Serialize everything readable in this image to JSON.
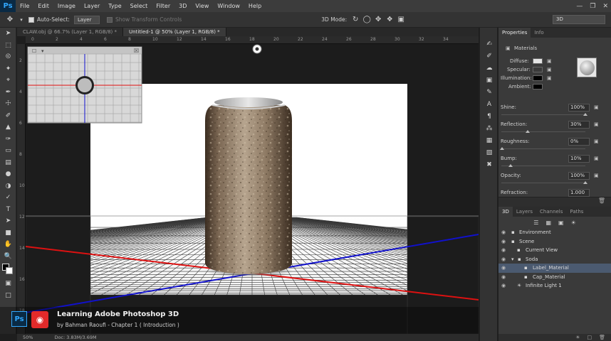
{
  "app": {
    "logo": "Ps"
  },
  "menu": [
    "File",
    "Edit",
    "Image",
    "Layer",
    "Type",
    "Select",
    "Filter",
    "3D",
    "View",
    "Window",
    "Help"
  ],
  "options": {
    "auto_select_label": "Auto-Select:",
    "auto_select_value": "Layer",
    "show_transform_label": "Show Transform Controls",
    "mode_label": "3D Mode:",
    "workspace": "3D"
  },
  "tabs": [
    {
      "label": "CLAW.obj @ 66.7% (Layer 1, RGB/8) *",
      "active": false
    },
    {
      "label": "Untitled-1 @ 50% (Layer 1, RGB/8) *",
      "active": true
    }
  ],
  "ruler_top": [
    "0",
    "2",
    "4",
    "6",
    "8",
    "10",
    "12",
    "14",
    "16",
    "18",
    "20",
    "22",
    "24",
    "26",
    "28",
    "30",
    "32",
    "34"
  ],
  "ruler_left": [
    "2",
    "4",
    "6",
    "8",
    "10",
    "12",
    "14",
    "16",
    "18"
  ],
  "status": {
    "zoom": "50%",
    "doc": "Doc: 3.83M/3.69M"
  },
  "properties": {
    "tabs": [
      "Properties",
      "Info"
    ],
    "section": "Materials",
    "diffuse_label": "Diffuse:",
    "specular_label": "Specular:",
    "illumination_label": "Illumination:",
    "ambient_label": "Ambient:",
    "shine_label": "Shine:",
    "shine_value": "100%",
    "reflection_label": "Reflection:",
    "reflection_value": "30%",
    "roughness_label": "Roughness:",
    "roughness_value": "0%",
    "bump_label": "Bump:",
    "bump_value": "10%",
    "opacity_label": "Opacity:",
    "opacity_value": "100%",
    "refraction_label": "Refraction:",
    "refraction_value": "1.000"
  },
  "scene_panel": {
    "tabs": [
      "3D",
      "Layers",
      "Channels",
      "Paths"
    ],
    "items": [
      {
        "label": "Environment",
        "selected": false
      },
      {
        "label": "Scene",
        "selected": false
      },
      {
        "label": "Current View",
        "selected": false
      },
      {
        "label": "Soda",
        "selected": false
      },
      {
        "label": "Label_Material",
        "selected": true
      },
      {
        "label": "Cap_Material",
        "selected": false
      },
      {
        "label": "Infinite Light 1",
        "selected": false
      }
    ]
  },
  "overlay": {
    "ps_logo": "Ps",
    "title": "Learning Adobe Photoshop 3D",
    "subtitle": "by Bahman Raoufi - Chapter 1 ( Introduction )"
  },
  "colors": {
    "accent": "#31a8ff",
    "selection": "#4b5a70",
    "x_axis": "#dd1111",
    "z_axis": "#1111cc"
  }
}
